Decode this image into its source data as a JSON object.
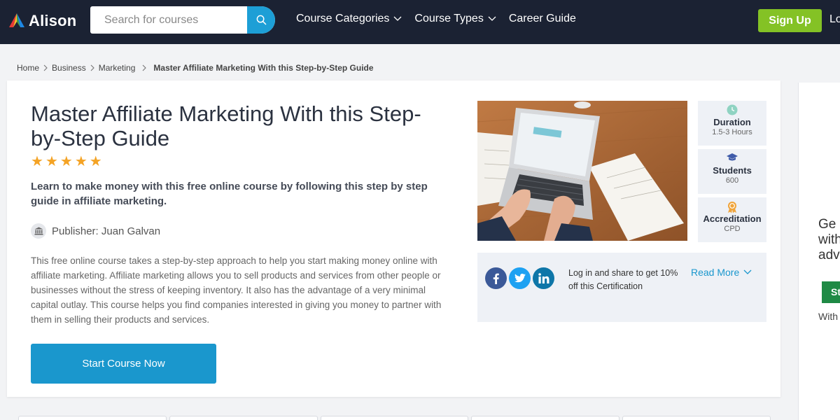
{
  "header": {
    "logo_text": "Alison",
    "search": {
      "placeholder": "Search for courses"
    },
    "nav": [
      {
        "label": "Course Categories"
      },
      {
        "label": "Course Types"
      },
      {
        "label": "Career Guide"
      }
    ],
    "signup_label": "Sign Up",
    "login_label": "Lo"
  },
  "breadcrumb": {
    "items": [
      "Home",
      "Business",
      "Marketing"
    ],
    "current": "Master Affiliate Marketing With this Step-by-Step Guide"
  },
  "course": {
    "title": "Master Affiliate Marketing With this Step-by-Step Guide",
    "rating_stars": 5,
    "subtitle": "Learn to make money with this free online course by following this step by step guide in affiliate marketing.",
    "publisher": "Publisher: Juan Galvan",
    "description": "This free online course takes a step-by-step approach to help you start making money online with affiliate marketing. Affiliate marketing allows you to sell products and services from other people or businesses without the stress of keeping inventory. It also has the advantage of a very minimal capital outlay. This course helps you find companies interested in giving you money to partner with them in selling their products and services.",
    "start_label": "Start Course Now"
  },
  "stats": [
    {
      "label": "Duration",
      "value": "1.5-3 Hours",
      "icon": "clock-icon"
    },
    {
      "label": "Students",
      "value": "600",
      "icon": "graduation-cap-icon"
    },
    {
      "label": "Accreditation",
      "value": "CPD",
      "icon": "award-icon"
    }
  ],
  "share": {
    "text": "Log in and share to get 10% off this Certification",
    "read_more": "Read More",
    "networks": [
      "facebook",
      "twitter",
      "linkedin"
    ]
  },
  "sidebar": {
    "text_lines": [
      "Ge",
      "with",
      "adv"
    ],
    "button_label": "St",
    "small_text": "With"
  },
  "colors": {
    "header_bg": "#1b2233",
    "accent_blue": "#1a97cd",
    "signup_green": "#84c225",
    "star": "#f4a325"
  }
}
